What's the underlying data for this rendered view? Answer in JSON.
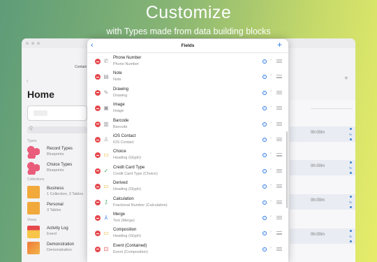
{
  "promo": {
    "headline": "Customize",
    "subline": "with Types made from data building blocks"
  },
  "background_app": {
    "contain_label": "Contain",
    "page_title": "Home",
    "search_glyph": "Q",
    "sections": {
      "types": "Types",
      "collections": "Collections",
      "views": "Views"
    },
    "rows": [
      {
        "title": "Record Types",
        "subtitle": "Blueprints",
        "icon": "pink-dots-icon"
      },
      {
        "title": "Choice Types",
        "subtitle": "Blueprints",
        "icon": "pink-dots-icon"
      },
      {
        "title": "Business",
        "subtitle": "1 Collection, 3 Tables",
        "icon": "folder-icon"
      },
      {
        "title": "Personal",
        "subtitle": "3 Tables",
        "icon": "folder-icon"
      },
      {
        "title": "Activity Log",
        "subtitle": "Event",
        "icon": "calendar-icon"
      },
      {
        "title": "Demonstration",
        "subtitle": "Demonstration",
        "icon": "orange-icon"
      }
    ],
    "right_times": [
      "0h:00m",
      "0h:00m",
      "0h:00m",
      "0h:00m"
    ]
  },
  "modal": {
    "title": "Fields",
    "back_icon": "chevron-left-icon",
    "add_icon": "plus-icon",
    "accent": "#2f7be6",
    "delete_color": "#e5484d",
    "fields": [
      {
        "name": "Phone Number",
        "type": "Phone Number",
        "icon": "phone-icon",
        "glyph": "✆",
        "color": "#9a9aa0"
      },
      {
        "name": "Note",
        "type": "Note",
        "icon": "note-icon",
        "glyph": "▤",
        "color": "#9a9aa0"
      },
      {
        "name": "Drawing",
        "type": "Drawing",
        "icon": "drawing-icon",
        "glyph": "✎",
        "color": "#9a9aa0"
      },
      {
        "name": "Image",
        "type": "Image",
        "icon": "image-icon",
        "glyph": "▣",
        "color": "#9a9aa0"
      },
      {
        "name": "Barcode",
        "type": "Barcode",
        "icon": "barcode-icon",
        "glyph": "▥",
        "color": "#9a9aa0"
      },
      {
        "name": "iOS Contact",
        "type": "iOS Contact",
        "icon": "contact-icon",
        "glyph": "♙",
        "color": "#9a9aa0"
      },
      {
        "name": "Choice",
        "type": "Heading (Glyph)",
        "icon": "heading-icon",
        "glyph": "▭",
        "color": "#e6a817"
      },
      {
        "name": "Credit Card Type",
        "type": "Credit Card Type (Choice)",
        "icon": "check-circle-icon",
        "glyph": "✓",
        "color": "#3aa35b"
      },
      {
        "name": "Derived",
        "type": "Heading (Glyph)",
        "icon": "heading-icon",
        "glyph": "▭",
        "color": "#e6a817"
      },
      {
        "name": "Calculation",
        "type": "Fractional Number (Calculation)",
        "icon": "calculation-icon",
        "glyph": "⁒",
        "color": "#3aa35b"
      },
      {
        "name": "Merge",
        "type": "Text (Merge)",
        "icon": "merge-icon",
        "glyph": "⅄",
        "color": "#2f7be6"
      },
      {
        "name": "Composition",
        "type": "Heading (Glyph)",
        "icon": "heading-icon",
        "glyph": "▭",
        "color": "#e6a817"
      },
      {
        "name": "Event (Contained)",
        "type": "Event (Composition)",
        "icon": "event-icon",
        "glyph": "⊡",
        "color": "#e5484d"
      }
    ]
  }
}
